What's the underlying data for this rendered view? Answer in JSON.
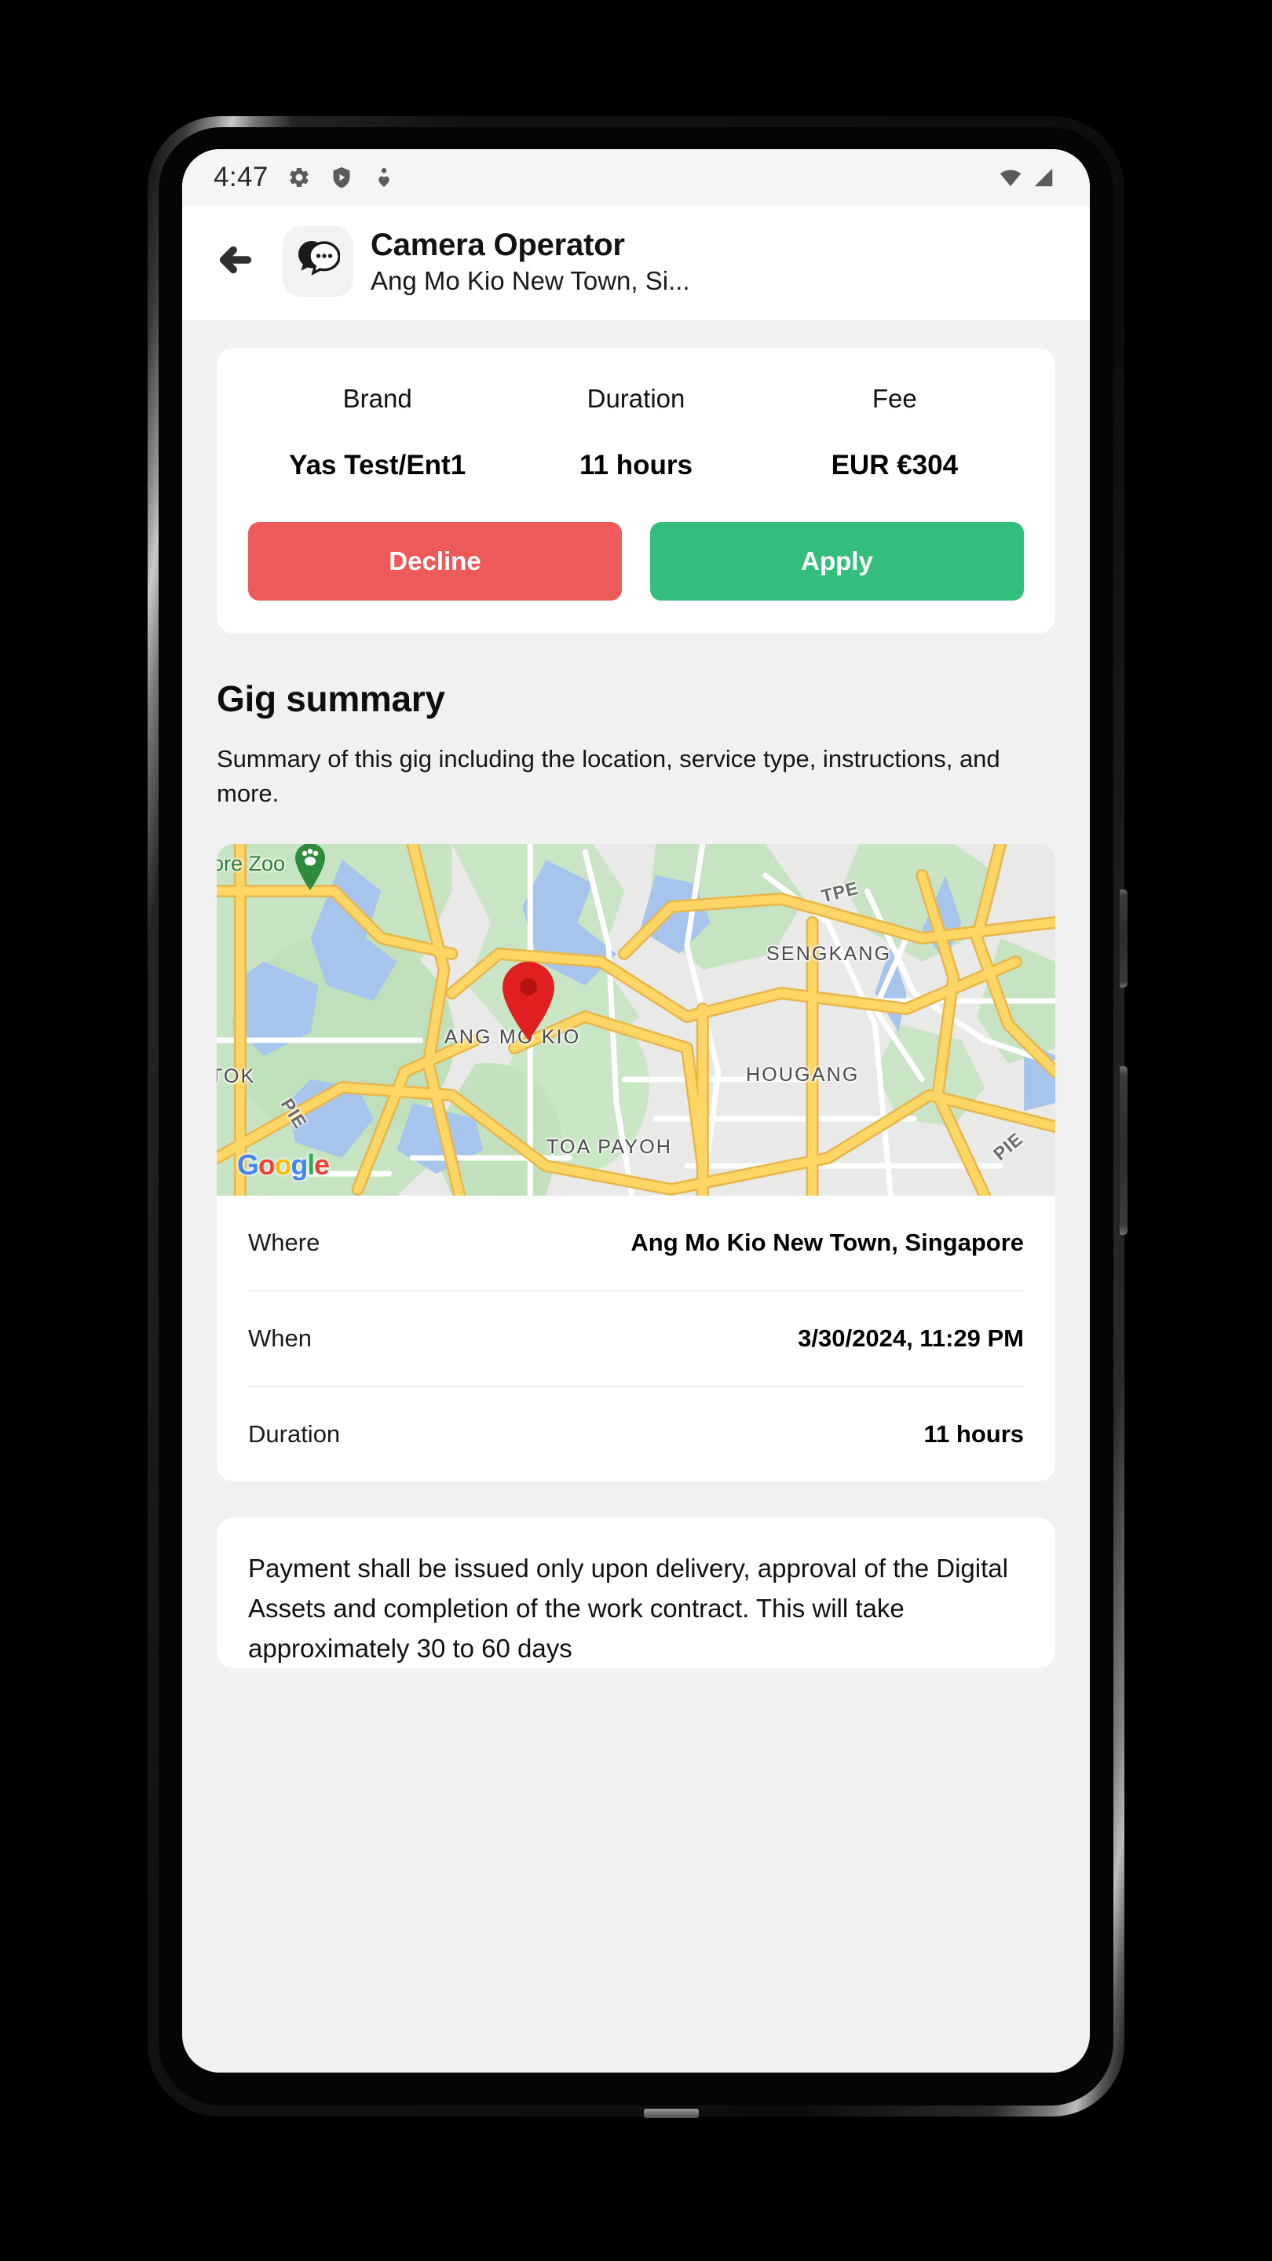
{
  "status_bar": {
    "time": "4:47",
    "left_icons": [
      "gear-icon",
      "shield-play-icon",
      "heart-person-icon"
    ],
    "right_icons": [
      "wifi-icon",
      "cellular-signal-icon"
    ]
  },
  "app_bar": {
    "back_icon": "back-arrow-icon",
    "logo_icon": "chat-bubbles-icon",
    "title": "Camera Operator",
    "subtitle": "Ang Mo Kio New Town, Si..."
  },
  "offer_card": {
    "stats": [
      {
        "label": "Brand",
        "value": "Yas Test/Ent1"
      },
      {
        "label": "Duration",
        "value": "11 hours"
      },
      {
        "label": "Fee",
        "value": "EUR €304"
      }
    ],
    "decline_label": "Decline",
    "apply_label": "Apply",
    "decline_color": "#EC5A5A",
    "apply_color": "#33BE7C"
  },
  "gig_summary": {
    "title": "Gig summary",
    "description": "Summary of this gig including the location, service type, instructions, and more."
  },
  "map": {
    "attribution": "Google",
    "marker_icon": "map-pin-icon",
    "zoo_pin_icon": "zoo-paw-pin-icon",
    "place_labels": [
      "ore Zoo",
      "SENGKANG",
      "ANG MO KIO",
      "HOUGANG",
      "TOA PAYOH",
      "TOK"
    ],
    "road_labels": [
      "TPE",
      "PIE",
      "PIE"
    ]
  },
  "details": [
    {
      "label": "Where",
      "value": "Ang Mo Kio New Town, Singapore"
    },
    {
      "label": "When",
      "value": "3/30/2024, 11:29 PM"
    },
    {
      "label": "Duration",
      "value": "11 hours"
    }
  ],
  "payment": {
    "text": "Payment shall be issued only upon delivery, approval of the Digital Assets and completion of the work contract. This will take approximately 30 to 60 days"
  }
}
